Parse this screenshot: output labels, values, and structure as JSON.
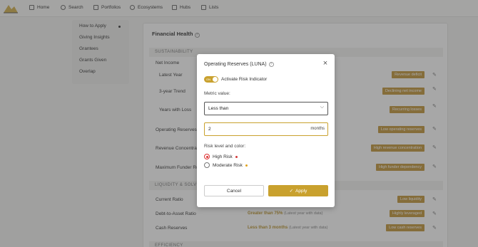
{
  "nav": {
    "items": [
      {
        "label": "Home",
        "icon": "home-icon"
      },
      {
        "label": "Search",
        "icon": "search-icon"
      },
      {
        "label": "Portfolios",
        "icon": "portfolio-icon"
      },
      {
        "label": "Ecosystems",
        "icon": "ecosystem-icon"
      },
      {
        "label": "Hubs",
        "icon": "hubs-icon"
      },
      {
        "label": "Lists",
        "icon": "lists-icon"
      }
    ]
  },
  "sidebar": {
    "items": [
      "How to Apply",
      "Giving Insights",
      "Grantees",
      "Grants Given",
      "Overlap"
    ]
  },
  "panel": {
    "title": "Financial Health",
    "sections": {
      "sustainability": "SUSTAINABILITY",
      "liquidity": "LIQUIDITY & SOLVE",
      "efficiency": "EFFICIENCY"
    },
    "net_income": "Net Income",
    "rows": {
      "latest_year": "Latest Year",
      "three_year": "3-year Trend",
      "years_loss": "Years with Loss",
      "operating_reserves": "Operating Reserves",
      "revenue_concentration": "Revenue Concentrat",
      "max_funder": "Maximum Funder Re",
      "current_ratio": "Current Ratio",
      "debt_asset": "Debt-to-Asset Ratio",
      "cash_reserves": "Cash Reserves"
    },
    "badges": {
      "revenue_deficit": "Revenue deficit",
      "declining": "Declining net income",
      "recurring": "Recurring losses",
      "low_reserves": "Low operating reserves",
      "high_concentration": "High revenue concentration",
      "funder_dependency": "High funder dependency",
      "low_liquidity": "Low liquidity",
      "highly_leveraged": "Highly leveraged",
      "low_cash": "Low cash reserves"
    },
    "conditions": {
      "debt": "Greater than 75%",
      "debt_note": "(Latest year with data)",
      "cash": "Less than 3 months",
      "cash_note": "(Latest year with data)"
    }
  },
  "modal": {
    "title": "Operating Reserves (LUNA)",
    "toggle_on_text": "ON",
    "toggle_label": "Activate Risk Indicator",
    "metric_label": "Metric value:",
    "select_value": "Less than",
    "input_value": "2",
    "input_suffix": "months",
    "risk_label": "Risk level and color:",
    "risk_options": [
      {
        "label": "High Risk",
        "color": "#d33a3a",
        "checked": true
      },
      {
        "label": "Moderate Risk",
        "color": "#e0a21e",
        "checked": false
      }
    ],
    "cancel": "Cancel",
    "apply": "Apply"
  },
  "colors": {
    "accent": "#c9a12e",
    "badge": "#c1953a",
    "high_risk": "#d33a3a",
    "moderate_risk": "#e0a21e"
  }
}
